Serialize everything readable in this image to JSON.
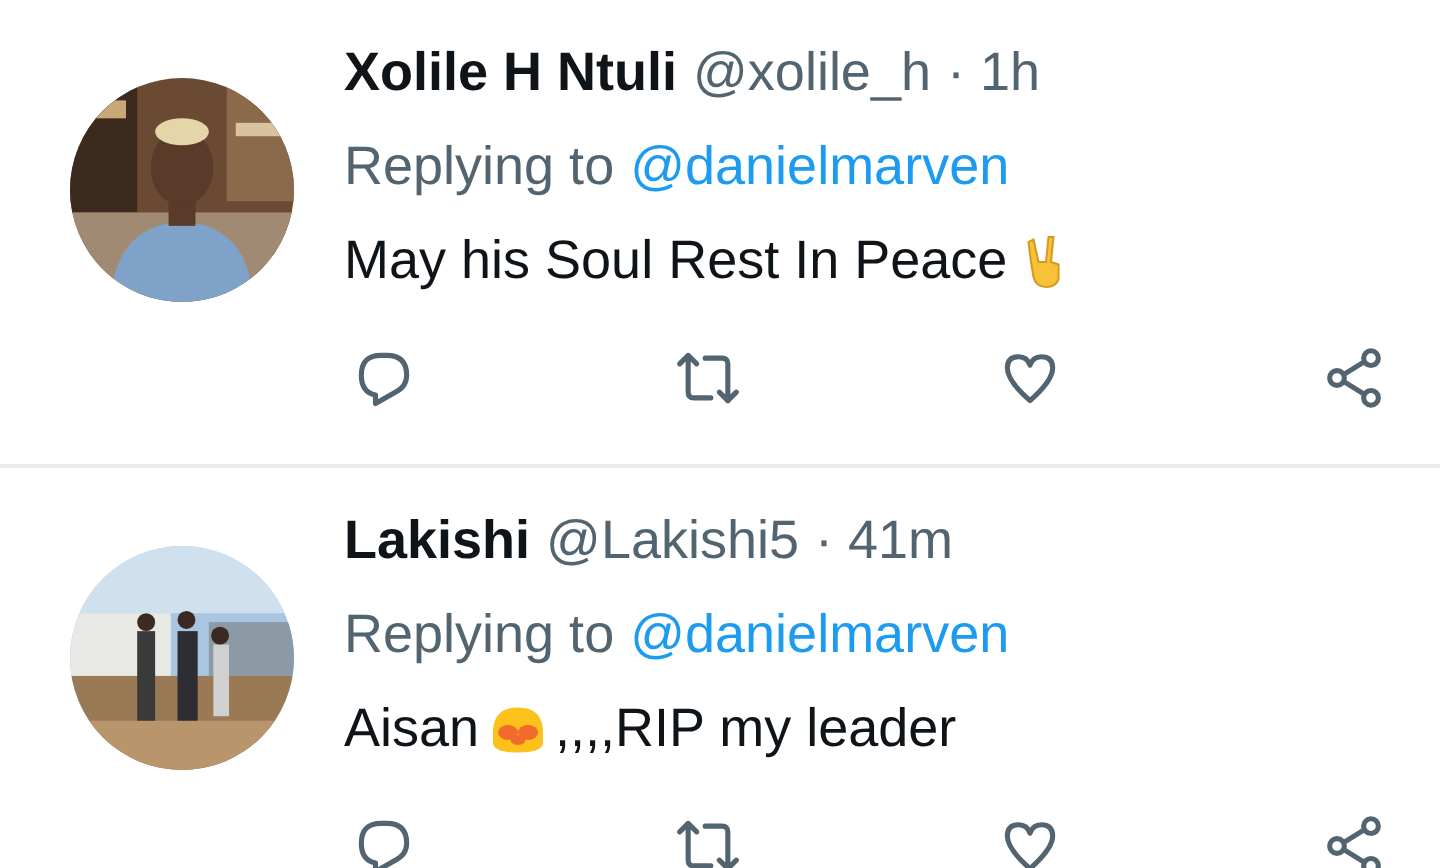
{
  "tweets": [
    {
      "avatar": {
        "kind": "picture"
      },
      "name": "Xolile H Ntuli",
      "handle": "@xolile_h",
      "time": "· 1h",
      "replying_label": "Replying to",
      "replying_to": "@danielmarven",
      "text": [
        {
          "kind": "text",
          "text": "May his Soul Rest In Peace"
        },
        {
          "kind": "emoji"
        }
      ]
    },
    {
      "avatar": {
        "kind": "picture"
      },
      "name": "Lakishi",
      "handle": "@Lakishi5",
      "time": "· 41m",
      "replying_label": "Replying to",
      "replying_to": "@danielmarven",
      "text": [
        {
          "kind": "text",
          "text": "Aisan"
        },
        {
          "kind": "emoji"
        },
        {
          "kind": "text",
          "text": ",,,,RIP my leader"
        }
      ]
    }
  ]
}
